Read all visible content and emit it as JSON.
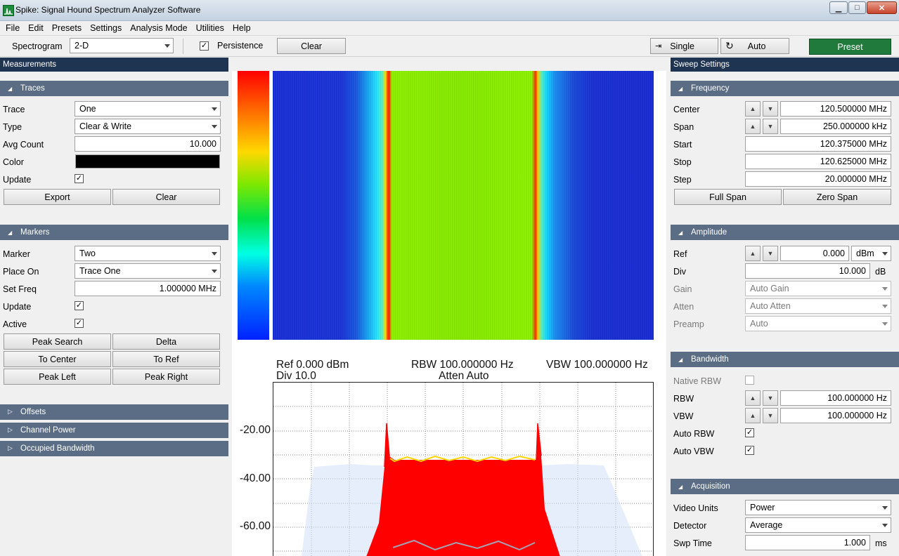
{
  "window": {
    "title": "Spike: Signal Hound Spectrum Analyzer Software",
    "minimize": "▁",
    "maximize": "□",
    "close": "✕"
  },
  "menu": [
    "File",
    "Edit",
    "Presets",
    "Settings",
    "Analysis Mode",
    "Utilities",
    "Help"
  ],
  "toolbar": {
    "spectrogram_label": "Spectrogram",
    "spectrogram_mode": "2-D",
    "persistence_label": "Persistence",
    "persistence_checked": "✓",
    "clear": "Clear",
    "single": "Single",
    "auto": "Auto",
    "preset": "Preset"
  },
  "left": {
    "title": "Measurements",
    "traces": {
      "header": "Traces",
      "trace_label": "Trace",
      "trace_value": "One",
      "type_label": "Type",
      "type_value": "Clear & Write",
      "avg_label": "Avg Count",
      "avg_value": "10.000",
      "color_label": "Color",
      "color_value": "#000000",
      "update_label": "Update",
      "update_checked": "✓",
      "export": "Export",
      "clear": "Clear"
    },
    "markers": {
      "header": "Markers",
      "marker_label": "Marker",
      "marker_value": "Two",
      "place_label": "Place On",
      "place_value": "Trace One",
      "setfreq_label": "Set Freq",
      "setfreq_value": "1.000000 MHz",
      "update_label": "Update",
      "update_checked": "✓",
      "active_label": "Active",
      "active_checked": "✓",
      "peak_search": "Peak Search",
      "delta": "Delta",
      "to_center": "To Center",
      "to_ref": "To Ref",
      "peak_left": "Peak Left",
      "peak_right": "Peak Right"
    },
    "collapsed": [
      "Offsets",
      "Channel Power",
      "Occupied Bandwidth"
    ]
  },
  "display": {
    "ref": "Ref 0.000 dBm",
    "div": "Div 10.0",
    "rbw": "RBW 100.000000 Hz",
    "atten": "Atten Auto",
    "vbw": "VBW 100.000000 Hz",
    "y_labels": [
      "-20.00",
      "-40.00",
      "-60.00"
    ]
  },
  "right": {
    "title": "Sweep Settings",
    "frequency": {
      "header": "Frequency",
      "center_label": "Center",
      "center_value": "120.500000 MHz",
      "span_label": "Span",
      "span_value": "250.000000 kHz",
      "start_label": "Start",
      "start_value": "120.375000 MHz",
      "stop_label": "Stop",
      "stop_value": "120.625000 MHz",
      "step_label": "Step",
      "step_value": "20.000000 MHz",
      "full_span": "Full Span",
      "zero_span": "Zero Span"
    },
    "amplitude": {
      "header": "Amplitude",
      "ref_label": "Ref",
      "ref_value": "0.000",
      "ref_unit": "dBm",
      "div_label": "Div",
      "div_value": "10.000",
      "div_unit": "dB",
      "gain_label": "Gain",
      "gain_value": "Auto Gain",
      "atten_label": "Atten",
      "atten_value": "Auto Atten",
      "preamp_label": "Preamp",
      "preamp_value": "Auto"
    },
    "bandwidth": {
      "header": "Bandwidth",
      "native_label": "Native RBW",
      "rbw_label": "RBW",
      "rbw_value": "100.000000 Hz",
      "vbw_label": "VBW",
      "vbw_value": "100.000000 Hz",
      "auto_rbw_label": "Auto RBW",
      "auto_rbw_checked": "✓",
      "auto_vbw_label": "Auto VBW",
      "auto_vbw_checked": "✓"
    },
    "acquisition": {
      "header": "Acquisition",
      "video_label": "Video Units",
      "video_value": "Power",
      "detector_label": "Detector",
      "detector_value": "Average",
      "swp_label": "Swp Time",
      "swp_value": "1.000",
      "swp_unit": "ms"
    }
  }
}
